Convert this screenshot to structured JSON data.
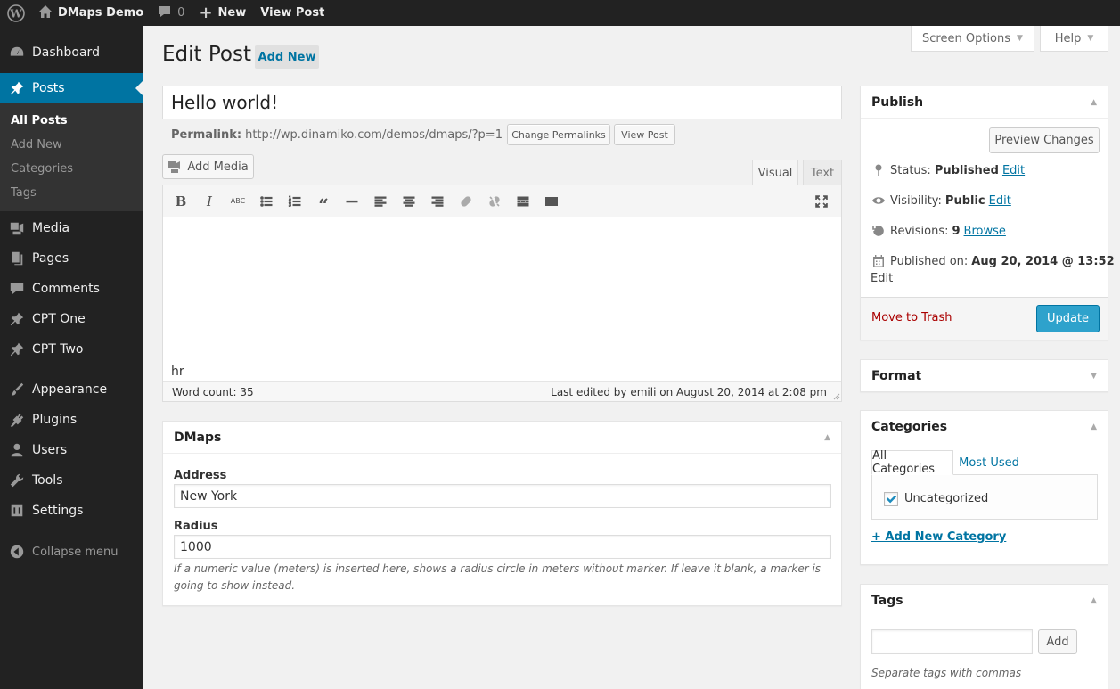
{
  "adminbar": {
    "site_name": "DMaps Demo",
    "comments_count": "0",
    "new_label": "New",
    "view_post_label": "View Post"
  },
  "sidebar": {
    "items": [
      {
        "label": "Dashboard",
        "icon": "dashboard-icon"
      },
      {
        "label": "Posts",
        "icon": "pushpin-icon"
      },
      {
        "label": "Media",
        "icon": "media-icon"
      },
      {
        "label": "Pages",
        "icon": "pages-icon"
      },
      {
        "label": "Comments",
        "icon": "comments-icon"
      },
      {
        "label": "CPT One",
        "icon": "pushpin-icon"
      },
      {
        "label": "CPT Two",
        "icon": "pushpin-icon"
      },
      {
        "label": "Appearance",
        "icon": "brush-icon"
      },
      {
        "label": "Plugins",
        "icon": "plug-icon"
      },
      {
        "label": "Users",
        "icon": "user-icon"
      },
      {
        "label": "Tools",
        "icon": "wrench-icon"
      },
      {
        "label": "Settings",
        "icon": "settings-icon"
      }
    ],
    "submenu": [
      "All Posts",
      "Add New",
      "Categories",
      "Tags"
    ],
    "collapse_label": "Collapse menu"
  },
  "header": {
    "screen_options": "Screen Options",
    "help": "Help",
    "page_title": "Edit Post",
    "add_new": "Add New"
  },
  "post": {
    "title": "Hello world!",
    "permalink_label": "Permalink:",
    "permalink_url": "http://wp.dinamiko.com/demos/dmaps/?p=1",
    "change_permalinks": "Change Permalinks",
    "view_post": "View Post"
  },
  "editor": {
    "add_media": "Add Media",
    "tab_visual": "Visual",
    "tab_text": "Text",
    "path": "hr",
    "word_count": "Word count: 35",
    "last_edited": "Last edited by emili on August 20, 2014 at 2:08 pm"
  },
  "dmaps": {
    "title": "DMaps",
    "address_label": "Address",
    "address_value": "New York",
    "radius_label": "Radius",
    "radius_value": "1000",
    "radius_desc": "If a numeric value (meters) is inserted here, shows a radius circle in meters without marker. If leave it blank, a marker is going to show instead."
  },
  "publish": {
    "title": "Publish",
    "preview": "Preview Changes",
    "status_label": "Status:",
    "status_value": "Published",
    "visibility_label": "Visibility:",
    "visibility_value": "Public",
    "revisions_label": "Revisions:",
    "revisions_value": "9",
    "browse": "Browse",
    "published_label": "Published on:",
    "published_value": "Aug 20, 2014 @ 13:52",
    "edit": "Edit",
    "trash": "Move to Trash",
    "update": "Update"
  },
  "format": {
    "title": "Format"
  },
  "categories": {
    "title": "Categories",
    "tab_all": "All Categories",
    "tab_used": "Most Used",
    "item": "Uncategorized",
    "checked": true,
    "add_new": "+ Add New Category"
  },
  "tags": {
    "title": "Tags",
    "add": "Add",
    "hint": "Separate tags with commas"
  },
  "colors": {
    "adminbar_bg": "#222222",
    "sidebar_active": "#0074a2",
    "link": "#0074a2",
    "primary_button": "#2ea2cc",
    "trash": "#aa0000"
  }
}
